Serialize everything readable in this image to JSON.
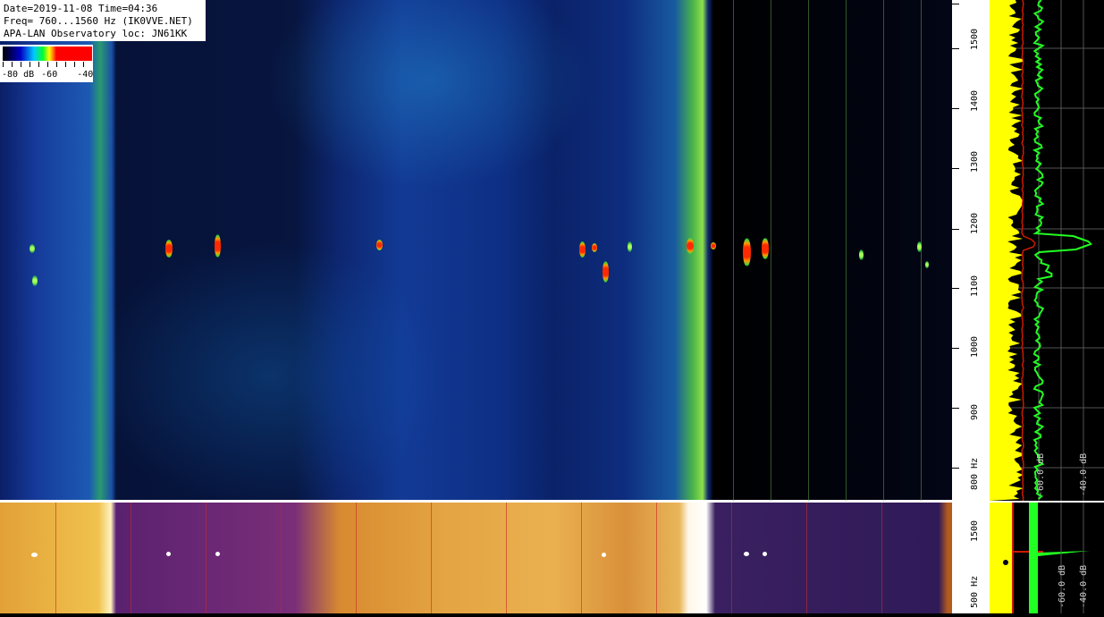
{
  "info": {
    "line1": "Date=2019-11-08 Time=04:36",
    "line2": "Freq= 760...1560 Hz (IK0VVE.NET)",
    "line3": "APA-LAN Observatory loc: JN61KK"
  },
  "legend": {
    "label_80": "-80 dB",
    "label_60": "-60",
    "label_40": "-40"
  },
  "freq_scale": {
    "labels": [
      "1500",
      "1400",
      "1300",
      "1200",
      "1100",
      "1000",
      "900",
      "800 Hz"
    ]
  },
  "spectrum": {
    "db_labels": [
      "-60.0 dB",
      "-40.0 dB"
    ],
    "colors": {
      "trace_yellow": "#ffff00",
      "trace_green": "#22ff22",
      "trace_red": "#cc1a00"
    }
  },
  "overview": {
    "freq_labels": [
      "1500",
      "500 Hz"
    ],
    "db_labels": [
      "-60.0 dB",
      "-40.0 dB"
    ]
  }
}
